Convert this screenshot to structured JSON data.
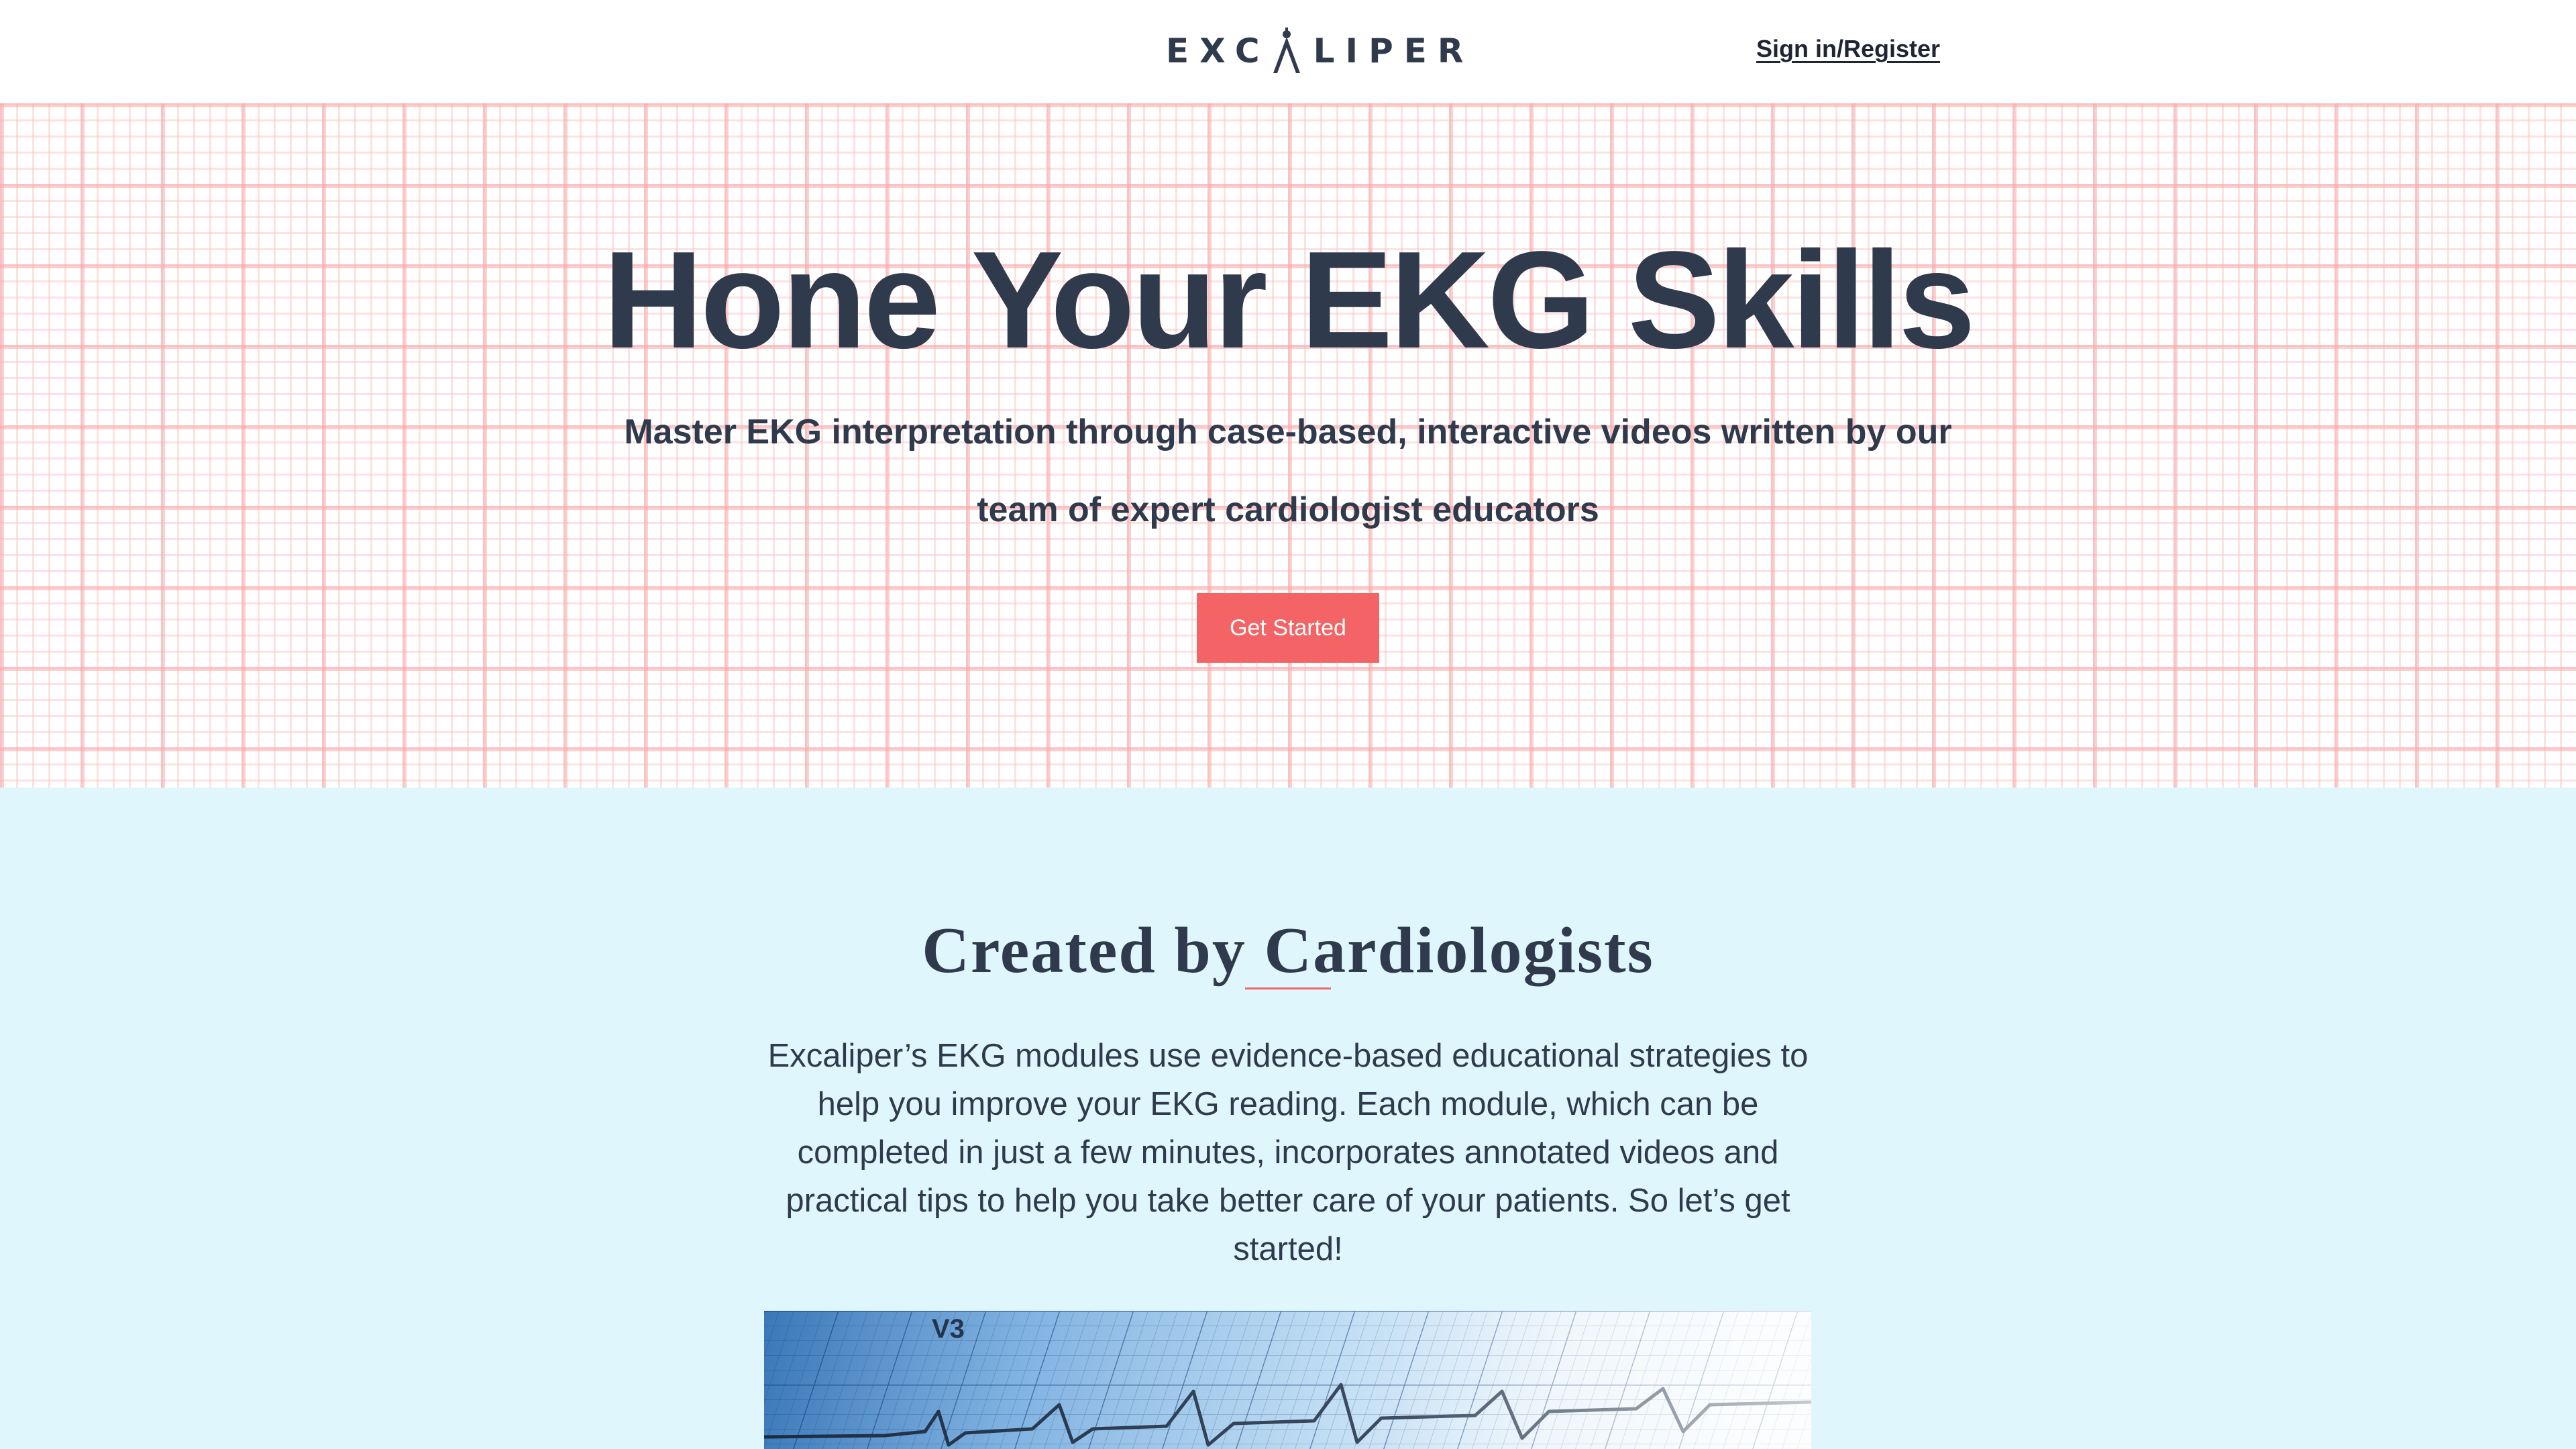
{
  "header": {
    "logo_text": "EXCALIPER",
    "logo_prefix": "EXC",
    "logo_suffix": "LIPER",
    "signin_label": "Sign in/Register"
  },
  "hero": {
    "title": "Hone Your EKG Skills",
    "subtitle": "Master EKG interpretation through case-based, interactive videos written by our team of expert cardiologist educators",
    "cta_label": "Get Started"
  },
  "cardiologists": {
    "title": "Created by Cardiologists",
    "body": "Excaliper’s EKG modules use evidence-based educational strategies to help you improve your EKG reading. Each module, which can be completed in just a few minutes, incorporates annotated videos and practical tips to help you take better care of your patients. So let’s get started!",
    "photo_label": "V3"
  },
  "colors": {
    "text": "#2f3a4d",
    "accent": "#f46466",
    "grid": "#f8aaaa",
    "section_bg": "#e0f6fd"
  },
  "icons": {
    "logo_mark": "caliper-icon"
  }
}
